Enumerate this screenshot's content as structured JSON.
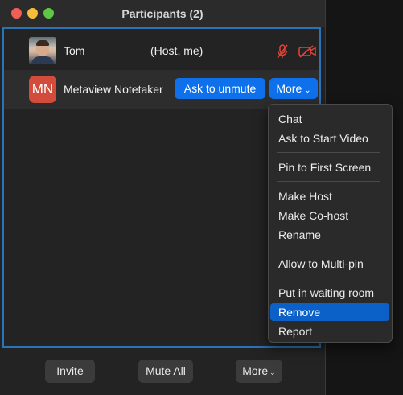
{
  "window": {
    "title": "Participants (2)"
  },
  "participants": [
    {
      "name": "Tom",
      "role": "(Host, me)"
    },
    {
      "name": "Metaview Notetaker",
      "initials": "MN",
      "unmute_label": "Ask to unmute",
      "more_label": "More"
    }
  ],
  "menu": {
    "items": [
      "Chat",
      "Ask to Start Video",
      "Pin to First Screen",
      "Make Host",
      "Make Co-host",
      "Rename",
      "Allow to Multi-pin",
      "Put in waiting room",
      "Remove",
      "Report"
    ],
    "selected": "Remove"
  },
  "footer": {
    "invite": "Invite",
    "mute_all": "Mute All",
    "more": "More"
  },
  "colors": {
    "accent": "#0e71eb",
    "selection": "#0b61c8",
    "avatar_mn": "#d24b3b",
    "muted_red": "#e0453a"
  }
}
